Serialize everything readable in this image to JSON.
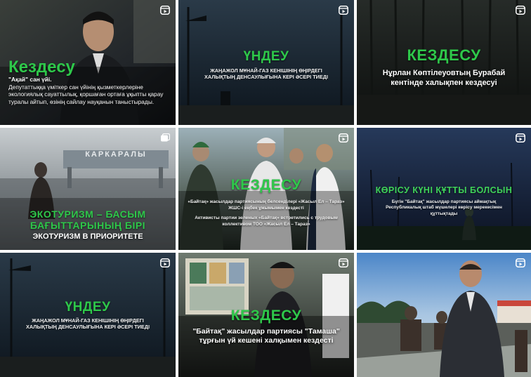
{
  "posts": [
    {
      "headline": "Кездесу",
      "quote": "\"Ақай\" сан үйі.",
      "body": "Депутаттыққа үміткер сан үйінің қызметкерлеріне экологиялық сауаттылық, қоршаған ортаға ұқыпты қарау туралы айтып, өзінің сайлау науқанын таныстырады.",
      "badge_icon": "reel-icon"
    },
    {
      "headline": "ҮНДЕУ",
      "subtitle": "ЖАҢАЖОЛ МҰНАЙ-ГАЗ КЕНІШІНІҢ ӨҢІРДЕГІ ХАЛЫҚТЫҢ ДЕНСАУЛЫҒЫНА КЕРІ ӘСЕРІ ТИЕДІ",
      "badge_icon": "reel-icon"
    },
    {
      "headline": "КЕЗДЕСУ",
      "subtitle": "Нұрлан Көптілеуовтың Бурабай кентінде халықпен кездесуі",
      "badge_icon": "reel-icon"
    },
    {
      "sign": "КАРКАРАЛЫ",
      "headline": "ЭКОТУРИЗМ – БАСЫМ БАҒЫТТАРЫНЫҢ БІРІ",
      "subtitle": "ЭКОТУРИЗМ В ПРИОРИТЕТЕ",
      "badge_icon": "carousel-icon"
    },
    {
      "headline": "КЕЗДЕСУ",
      "subtitle": "«Байтақ» жасылдар партиясының белсенділері «Жасыл Ел – Тараз» ЖШС-і еңбек ұжымымен кездесті",
      "subtitle_ru": "Активисты партии зеленых «Байтақ» встретились с трудовым коллективом ТОО «Жасыл Ел – Тараз»",
      "badge_icon": "reel-icon"
    },
    {
      "headline": "КӨРІСУ КҮНІ ҚҰТТЫ БОЛСЫН",
      "subtitle": "Бүгін \"Байтақ\" жасылдар партиясы аймақтық Республикалық штаб мүшелері көрісу мерекесімен құттықтады",
      "badge_icon": "reel-icon"
    },
    {
      "headline": "ҮНДЕУ",
      "subtitle": "ЖАҢАЖОЛ МҰНАЙ-ГАЗ КЕНІШІНІҢ ӨҢІРДЕГІ ХАЛЫҚТЫҢ ДЕНСАУЛЫҒЫНА КЕРІ ӘСЕРІ ТИЕДІ",
      "badge_icon": "reel-icon"
    },
    {
      "headline": "КЕЗДЕСУ",
      "subtitle": "\"Байтақ\" жасылдар партиясы \"Тамаша\" тұрғын үй кешені халқымен кездесті",
      "badge_icon": "reel-icon"
    },
    {
      "badge_icon": "reel-icon"
    }
  ],
  "colors": {
    "accent_green": "#2ec84a",
    "badge_white": "#ffffff"
  }
}
